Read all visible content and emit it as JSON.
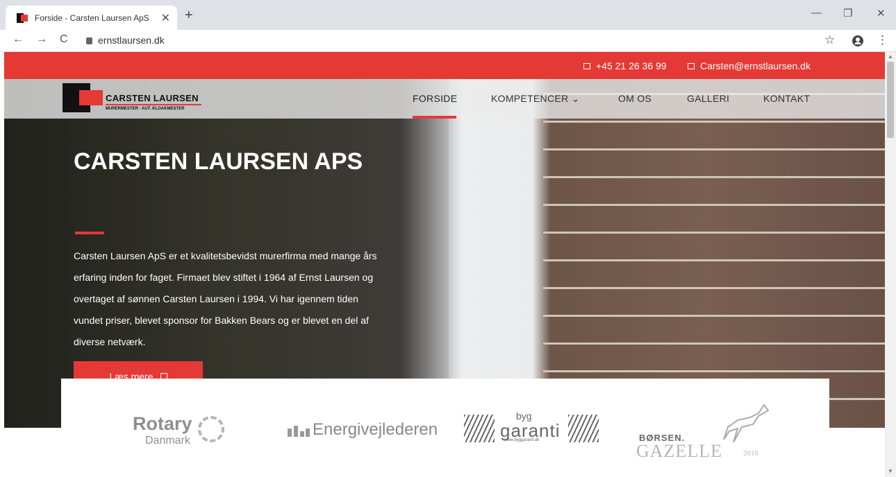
{
  "browser": {
    "tab_title": "Forside - Carsten Laursen ApS",
    "tab_close": "✕",
    "new_tab": "+",
    "url": "ernstlaursen.dk",
    "back": "←",
    "forward": "→",
    "reload": "C",
    "star": "☆",
    "menu": "⋮",
    "minimize": "—",
    "restore": "❐",
    "close": "✕"
  },
  "topbar": {
    "phone": "+45 21 26 36 99",
    "email": "Carsten@ernstlaursen.dk",
    "background": "#e53935"
  },
  "logo": {
    "name": "CARSTEN LAURSEN",
    "subtitle": "MURERMESTER - AUT. KLOAKMESTER"
  },
  "nav": {
    "items": [
      {
        "label": "FORSIDE",
        "active": true
      },
      {
        "label": "KOMPETENCER ⌄",
        "active": false
      },
      {
        "label": "OM OS",
        "active": false
      },
      {
        "label": "GALLERI",
        "active": false
      },
      {
        "label": "KONTAKT",
        "active": false
      }
    ]
  },
  "hero": {
    "title": "CARSTEN LAURSEN APS",
    "text": "Carsten Laursen ApS er et kvalitetsbevidst murerfirma med mange års erfaring inden for faget. Firmaet blev stiftet i 1964 af Ernst Laursen og overtaget af sønnen Carsten Laursen i 1994. Vi har igennem tiden vundet priser, blevet sponsor for Bakken Bears og er blevet en del af diverse netværk.",
    "button": "Læs mere"
  },
  "partners": {
    "rotary": {
      "word": "Rotary",
      "sub": "Danmark"
    },
    "energi": {
      "word": "Energivejlederen"
    },
    "byggaranti": {
      "small": "byg",
      "big": "garanti",
      "url": "www.byggaranti.dk"
    },
    "borsen": {
      "word": "BØRSEN.",
      "gazelle": "GAZELLE",
      "year": "2016"
    }
  },
  "accent_color": "#e53935",
  "icons": [
    "lock-icon",
    "phone-icon",
    "mail-icon",
    "account-icon",
    "favicon-icon"
  ]
}
